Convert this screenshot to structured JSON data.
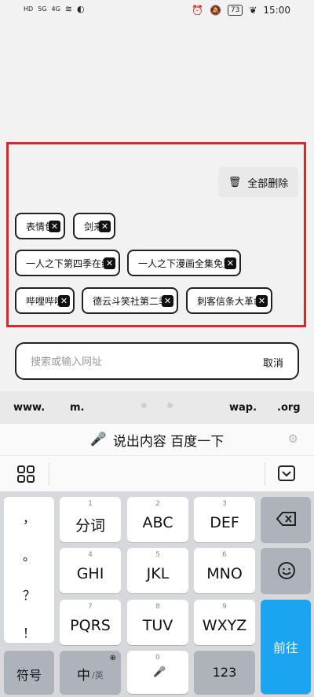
{
  "status": {
    "left_indicators": [
      "HD",
      "5G",
      "4G"
    ],
    "battery": "73",
    "time": "15:00"
  },
  "history": {
    "clear_all_label": "全部删除",
    "chips": [
      "表情包",
      "剑来",
      "一人之下第四季在线",
      "一人之下漫画全集免费",
      "哔哩哔哩",
      "德云斗笑社第二季",
      "刺客信条大革命"
    ]
  },
  "search": {
    "placeholder": "搜索或输入网址",
    "cancel_label": "取消"
  },
  "quick": {
    "items": [
      "www.",
      "m.",
      "wap.",
      ".org"
    ]
  },
  "voice": {
    "label": "说出内容 百度一下"
  },
  "keyboard": {
    "punctuation": [
      "，",
      "。",
      "？",
      "！"
    ],
    "keys": [
      {
        "num": "1",
        "label": "分词"
      },
      {
        "num": "2",
        "label": "ABC"
      },
      {
        "num": "3",
        "label": "DEF"
      },
      {
        "num": "4",
        "label": "GHI"
      },
      {
        "num": "5",
        "label": "JKL"
      },
      {
        "num": "6",
        "label": "MNO"
      },
      {
        "num": "7",
        "label": "PQRS"
      },
      {
        "num": "8",
        "label": "TUV"
      },
      {
        "num": "9",
        "label": "WXYZ"
      }
    ],
    "symbol_label": "符号",
    "lang_label": "中",
    "lang_sub": "/英",
    "space_num": "0",
    "num_label": "123",
    "go_label": "前往"
  }
}
